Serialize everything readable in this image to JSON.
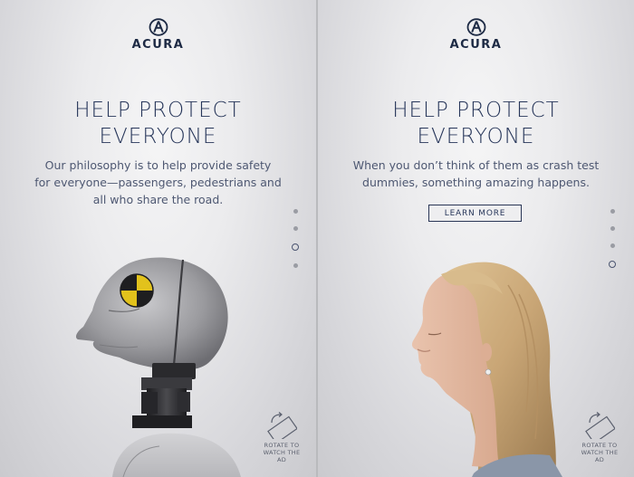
{
  "left_panel": {
    "brand": "ACURA",
    "headline_line1": "HELP PROTECT",
    "headline_line2": "EVERYONE",
    "body_line1": "Our philosophy is to help provide safety",
    "body_line2": "for everyone—passengers, pedestrians and",
    "body_line3": "all who share the road.",
    "pagination_count": 4,
    "pagination_active": 3,
    "rotate_line1": "ROTATE TO",
    "rotate_line2": "WATCH THE AD",
    "figure_icon": "crash-test-dummy-icon"
  },
  "right_panel": {
    "brand": "ACURA",
    "headline_line1": "HELP PROTECT",
    "headline_line2": "EVERYONE",
    "body_line1": "When you don’t think of them as crash test",
    "body_line2": "dummies, something amazing happens.",
    "cta_label": "LEARN MORE",
    "pagination_count": 4,
    "pagination_active": 4,
    "rotate_line1": "ROTATE TO",
    "rotate_line2": "WATCH THE AD",
    "figure_icon": "woman-profile-photo"
  },
  "colors": {
    "brand_navy": "#1d2a44",
    "headline": "#27365a",
    "body_text": "#4e5872",
    "dummy_yellow": "#e2c21c",
    "hair_blonde": "#c9a676"
  }
}
